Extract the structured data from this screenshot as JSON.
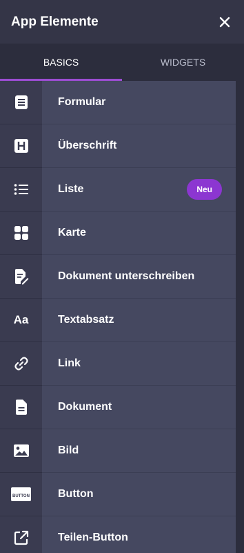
{
  "header": {
    "title": "App Elemente"
  },
  "tabs": [
    {
      "label": "BASICS",
      "active": true
    },
    {
      "label": "WIDGETS",
      "active": false
    }
  ],
  "items": [
    {
      "label": "Formular",
      "icon": "form-icon"
    },
    {
      "label": "Überschrift",
      "icon": "heading-icon"
    },
    {
      "label": "Liste",
      "icon": "list-icon",
      "badge": "Neu"
    },
    {
      "label": "Karte",
      "icon": "card-icon"
    },
    {
      "label": "Dokument unterschreiben",
      "icon": "sign-document-icon"
    },
    {
      "label": "Textabsatz",
      "icon": "text-icon",
      "icon_text": "Aa"
    },
    {
      "label": "Link",
      "icon": "link-icon"
    },
    {
      "label": "Dokument",
      "icon": "document-icon"
    },
    {
      "label": "Bild",
      "icon": "image-icon"
    },
    {
      "label": "Button",
      "icon": "button-icon",
      "icon_text": "BUTTON"
    },
    {
      "label": "Teilen-Button",
      "icon": "share-icon"
    }
  ],
  "colors": {
    "accent": "#9c4dd3",
    "badge": "#8c36d1"
  }
}
